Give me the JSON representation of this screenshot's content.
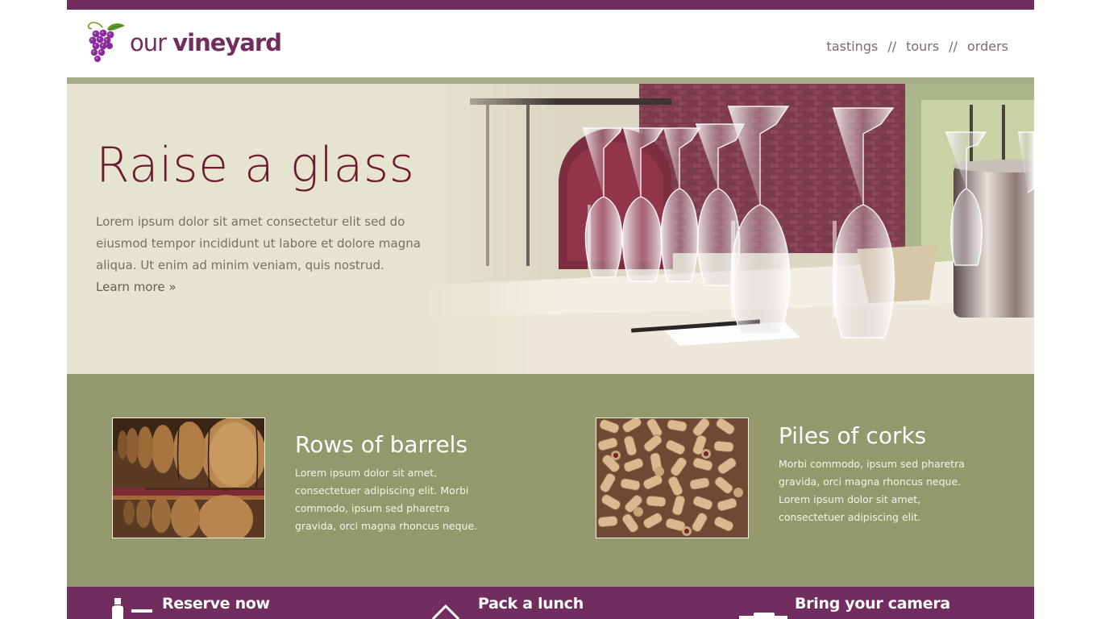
{
  "brand": {
    "name_part1": "our",
    "name_part2": "vineyard"
  },
  "nav": {
    "items": [
      {
        "label": "tastings"
      },
      {
        "label": "tours"
      },
      {
        "label": "orders"
      }
    ],
    "separator": "//"
  },
  "hero": {
    "title": "Raise a glass",
    "body": "Lorem ipsum dolor sit amet consectetur elit sed do eiusmod tempor incididunt ut labore et dolore magna aliqua. Ut enim ad minim veniam, quis nostrud.",
    "link": "Learn more »"
  },
  "features": [
    {
      "title": "Rows of barrels",
      "body": "Lorem ipsum dolor sit amet, consectetuer adipiscing elit. Morbi commodo, ipsum sed pharetra gravida, orci magna rhoncus neque."
    },
    {
      "title": "Piles of corks",
      "body": "Morbi commodo, ipsum sed pharetra gravida, orci magna rhoncus neque. Lorem ipsum dolor sit amet, consectetuer adipiscing elit."
    }
  ],
  "cta": [
    {
      "label": "Reserve now",
      "icon": "wine-bottle-icon"
    },
    {
      "label": "Pack a lunch",
      "icon": "picnic-basket-icon"
    },
    {
      "label": "Bring your camera",
      "icon": "camera-icon"
    }
  ],
  "colors": {
    "plum": "#712d5e",
    "olive": "#94996d",
    "cream": "#e6e3cf",
    "hero_title": "#6b1a2f"
  }
}
